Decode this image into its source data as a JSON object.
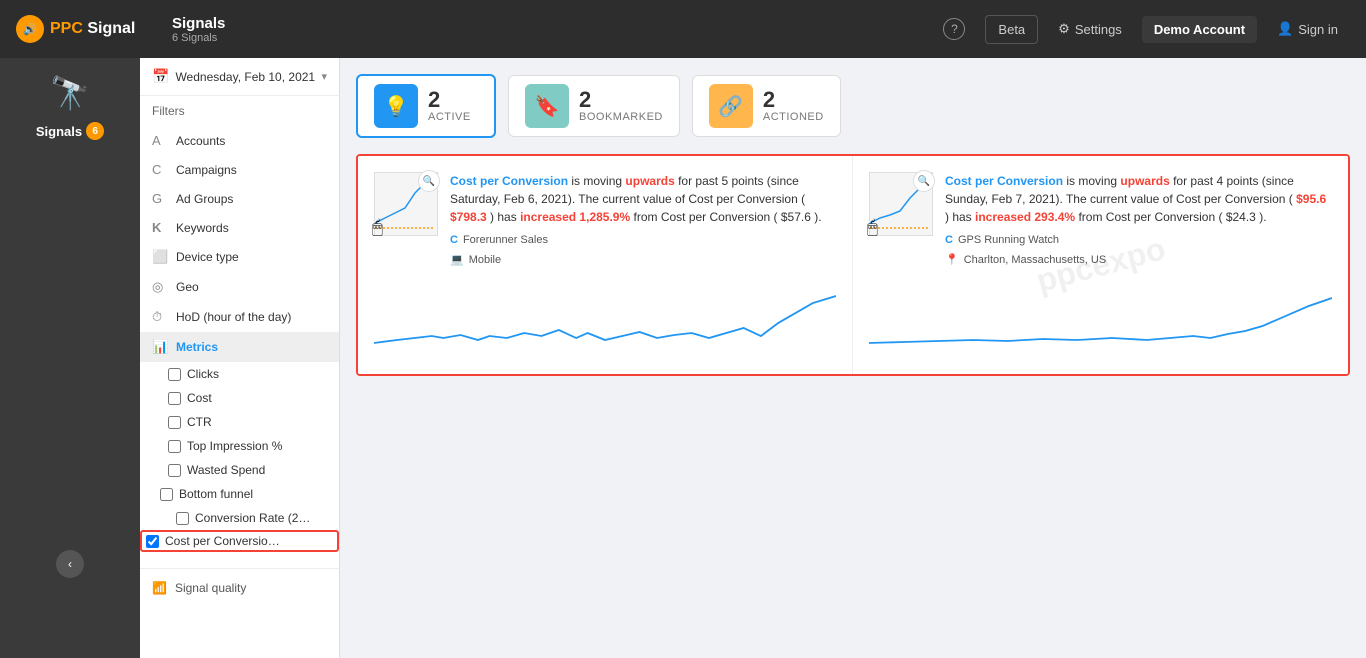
{
  "topNav": {
    "logo": "PPC Signal",
    "logoHighlight": "PPC",
    "title": "Signals",
    "subtitle": "6 Signals",
    "helpLabel": "?",
    "betaLabel": "Beta",
    "settingsLabel": "Settings",
    "demoAccount": "Demo Account",
    "signIn": "Sign in"
  },
  "sidebar": {
    "label": "Signals",
    "badgeCount": "6"
  },
  "filters": {
    "date": "Wednesday, Feb 10, 2021",
    "title": "Filters",
    "items": [
      {
        "icon": "A",
        "label": "Accounts"
      },
      {
        "icon": "C",
        "label": "Campaigns"
      },
      {
        "icon": "G",
        "label": "Ad Groups"
      },
      {
        "icon": "K",
        "label": "Keywords"
      },
      {
        "icon": "D",
        "label": "Device type"
      },
      {
        "icon": "◎",
        "label": "Geo"
      },
      {
        "icon": "⏱",
        "label": "HoD (hour of the day)"
      }
    ],
    "metrics": {
      "label": "Metrics",
      "checkboxes": [
        {
          "id": "clicks",
          "label": "Clicks",
          "checked": false
        },
        {
          "id": "cost",
          "label": "Cost",
          "checked": false
        },
        {
          "id": "ctr",
          "label": "CTR",
          "checked": false
        },
        {
          "id": "topImpression",
          "label": "Top Impression %",
          "checked": false
        },
        {
          "id": "wastedSpend",
          "label": "Wasted Spend",
          "checked": false
        }
      ],
      "bottomFunnel": {
        "label": "Bottom funnel",
        "sub": [
          {
            "id": "convRate",
            "label": "Conversion Rate (2…",
            "checked": false
          },
          {
            "id": "costConv",
            "label": "Cost per Conversio…",
            "checked": true
          }
        ]
      }
    }
  },
  "tabs": [
    {
      "id": "active",
      "icon": "💡",
      "count": "2",
      "label": "Active",
      "active": true,
      "iconBg": "blue"
    },
    {
      "id": "bookmarked",
      "icon": "🔖",
      "count": "2",
      "label": "Bookmarked",
      "active": false,
      "iconBg": "teal"
    },
    {
      "id": "actioned",
      "icon": "🔗",
      "count": "2",
      "label": "Actioned",
      "active": false,
      "iconBg": "orange"
    }
  ],
  "signals": [
    {
      "id": "signal-1",
      "text_before": "Cost per Conversion",
      "text_link1": "Cost per Conversion",
      "text1": " is moving ",
      "text_up1": "upwards",
      "text2": " for past 5 points (since Saturday, Feb 6, 2021). The current value of Cost per Conversion (",
      "text_val1": "$798.3",
      "text3": ") has ",
      "text_highlight1": "increased 1,285.9%",
      "text4": " from Cost per Conversion (",
      "text_val2": "$57.6",
      "text5": ").",
      "campaign": "Forerunner Sales",
      "device": "Mobile",
      "campaignIcon": "C",
      "deviceIcon": "💻"
    },
    {
      "id": "signal-2",
      "text_before": "Cost per Conversion",
      "text_link1": "Cost per Conversion",
      "text1": " is moving ",
      "text_up1": "upwards",
      "text2": " for past 4 points (since Sunday, Feb 7, 2021). The current value of Cost per Conversion (",
      "text_val1": "$95.6",
      "text3": ") has ",
      "text_highlight1": "increased 293.4%",
      "text4": " from Cost per Conversion (",
      "text_val2": "$24.3",
      "text5": ").",
      "campaign": "GPS Running Watch",
      "location": "Charlton, Massachusetts, US",
      "campaignIcon": "C",
      "locationIcon": "📍"
    }
  ],
  "signalQuality": {
    "label": "Signal quality"
  },
  "watermark": "ppcexpo"
}
